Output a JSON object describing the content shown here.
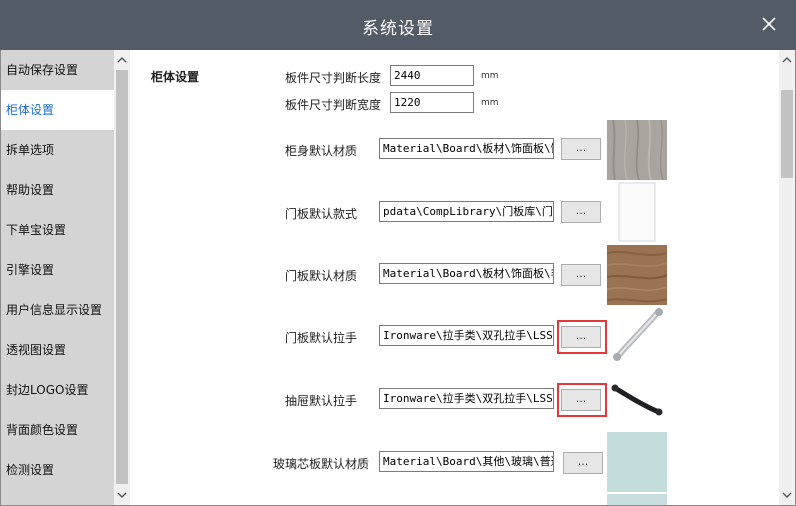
{
  "window": {
    "title": "系统设置"
  },
  "sidebar": {
    "items": [
      {
        "label": "自动保存设置"
      },
      {
        "label": "柜体设置"
      },
      {
        "label": "拆单选项"
      },
      {
        "label": "帮助设置"
      },
      {
        "label": "下单宝设置"
      },
      {
        "label": "引擎设置"
      },
      {
        "label": "用户信息显示设置"
      },
      {
        "label": "透视图设置"
      },
      {
        "label": "封边LOGO设置"
      },
      {
        "label": "背面颜色设置"
      },
      {
        "label": "检测设置"
      },
      {
        "label": ""
      }
    ],
    "active_index": 1
  },
  "section": {
    "title": "柜体设置"
  },
  "panel_length": {
    "label": "板件尺寸判断长度",
    "value": "2440",
    "unit": "mm"
  },
  "panel_width": {
    "label": "板件尺寸判断宽度",
    "value": "1220",
    "unit": "mm"
  },
  "rows": [
    {
      "label": "柜身默认材质",
      "value": "Material\\Board\\板材\\饰面板\\饰",
      "button": "...",
      "highlighted": false,
      "thumb": "wood-grey"
    },
    {
      "label": "门板默认款式",
      "value": "pdata\\CompLibrary\\门板库\\门板",
      "button": "...",
      "highlighted": false,
      "thumb": "white-door"
    },
    {
      "label": "门板默认材质",
      "value": "Material\\Board\\板材\\饰面板\\非",
      "button": "...",
      "highlighted": false,
      "thumb": "wood-brown"
    },
    {
      "label": "门板默认拉手",
      "value": "Ironware\\拉手类\\双孔拉手\\LSS",
      "button": "...",
      "highlighted": true,
      "thumb": "silver-handle"
    },
    {
      "label": "抽屉默认拉手",
      "value": "Ironware\\拉手类\\双孔拉手\\LSS",
      "button": "...",
      "highlighted": true,
      "thumb": "black-handle"
    },
    {
      "label": "玻璃芯板默认材质",
      "value": "Material\\Board\\其他\\玻璃\\普通",
      "button": "...",
      "highlighted": false,
      "thumb": "glass"
    }
  ],
  "icons": {
    "close": "close-icon",
    "scroll_up": "chevron-up-icon",
    "scroll_down": "chevron-down-icon"
  },
  "colors": {
    "titlebar": "#535c66",
    "sidebar": "#d4d4d4",
    "active_item_text": "#1a6fd1",
    "highlight": "#e53935"
  }
}
